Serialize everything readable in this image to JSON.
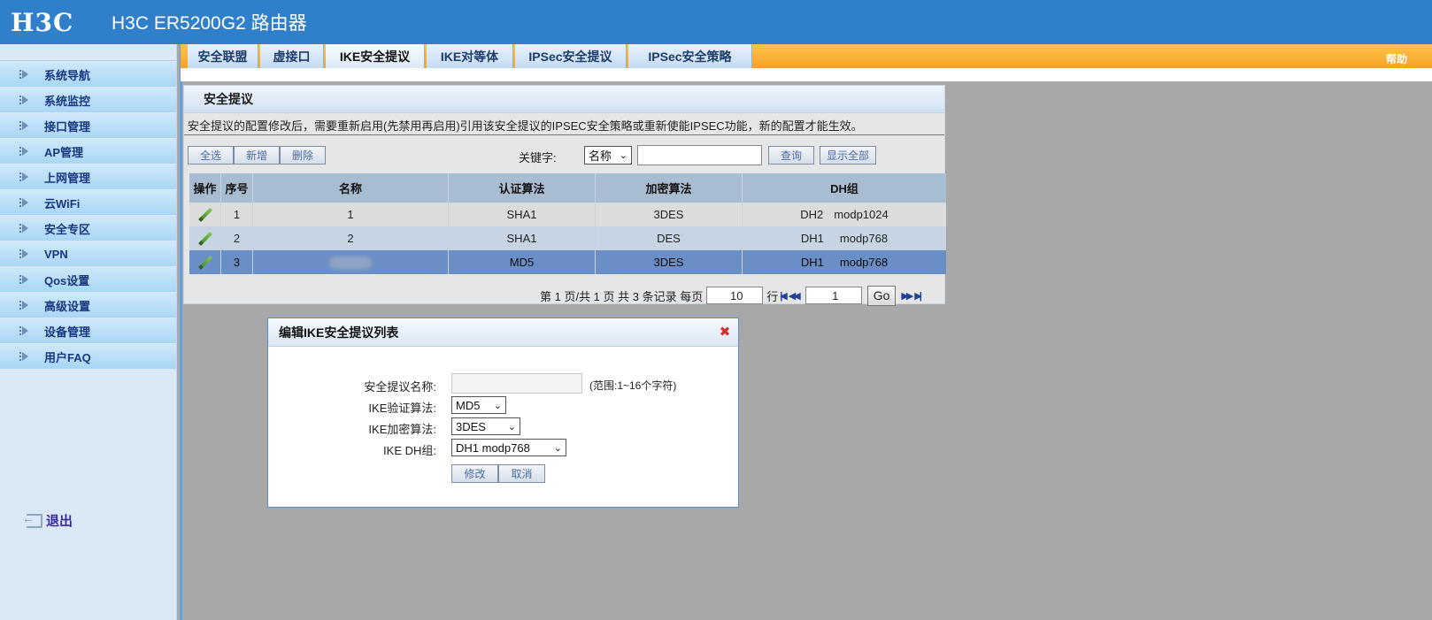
{
  "header": {
    "logo": "H3C",
    "title": "H3C ER5200G2 路由器"
  },
  "sidebar": {
    "items": [
      {
        "label": "系统导航"
      },
      {
        "label": "系统监控"
      },
      {
        "label": "接口管理"
      },
      {
        "label": "AP管理"
      },
      {
        "label": "上网管理"
      },
      {
        "label": "云WiFi"
      },
      {
        "label": "安全专区"
      },
      {
        "label": "VPN"
      },
      {
        "label": "Qos设置"
      },
      {
        "label": "高级设置"
      },
      {
        "label": "设备管理"
      },
      {
        "label": "用户FAQ"
      }
    ],
    "logout": "退出"
  },
  "tabs": [
    {
      "label": "安全联盟"
    },
    {
      "label": "虚接口"
    },
    {
      "label": "IKE安全提议"
    },
    {
      "label": "IKE对等体"
    },
    {
      "label": "IPSec安全提议"
    },
    {
      "label": "IPSec安全策略"
    }
  ],
  "active_tab": "IKE安全提议",
  "help": "帮助",
  "panel": {
    "title": "安全提议",
    "notice": "安全提议的配置修改后，需要重新启用(先禁用再启用)引用该安全提议的IPSEC安全策略或重新使能IPSEC功能，新的配置才能生效。",
    "toolbar": {
      "select_all": "全选",
      "add": "新增",
      "delete": "删除",
      "keyword_label": "关键字:",
      "keyword_option": "名称",
      "search_value": "",
      "query": "查询",
      "show_all": "显示全部"
    },
    "table": {
      "headers": [
        "操作",
        "序号",
        "名称",
        "认证算法",
        "加密算法",
        "DH组"
      ],
      "rows": [
        {
          "index": "1",
          "name": "1",
          "auth": "SHA1",
          "enc": "3DES",
          "dh": "DH2",
          "dh_mode": "modp1024"
        },
        {
          "index": "2",
          "name": "2",
          "auth": "SHA1",
          "enc": "DES",
          "dh": "DH1",
          "dh_mode": "modp768"
        },
        {
          "index": "3",
          "name": "",
          "auth": "MD5",
          "enc": "3DES",
          "dh": "DH1",
          "dh_mode": "modp768"
        }
      ]
    },
    "pager": {
      "summary": "第 1 页/共 1 页 共 3 条记录 每页",
      "per_page": "10",
      "row_unit": "行",
      "page": "1",
      "go": "Go"
    }
  },
  "modal": {
    "title": "编辑IKE安全提议列表",
    "fields": {
      "name_label": "安全提议名称:",
      "name_value": "",
      "name_hint": "(范围:1~16个字符)",
      "auth_label": "IKE验证算法:",
      "auth_value": "MD5",
      "enc_label": "IKE加密算法:",
      "enc_value": "3DES",
      "dh_label": "IKE DH组:",
      "dh_value": "DH1 modp768"
    },
    "modify": "修改",
    "cancel": "取消"
  },
  "colors": {
    "header_bg": "#2f7fcb",
    "tabbar_orange": "#f5a224",
    "selected_row": "#6a8fc6",
    "close_red": "#d32a2a"
  }
}
